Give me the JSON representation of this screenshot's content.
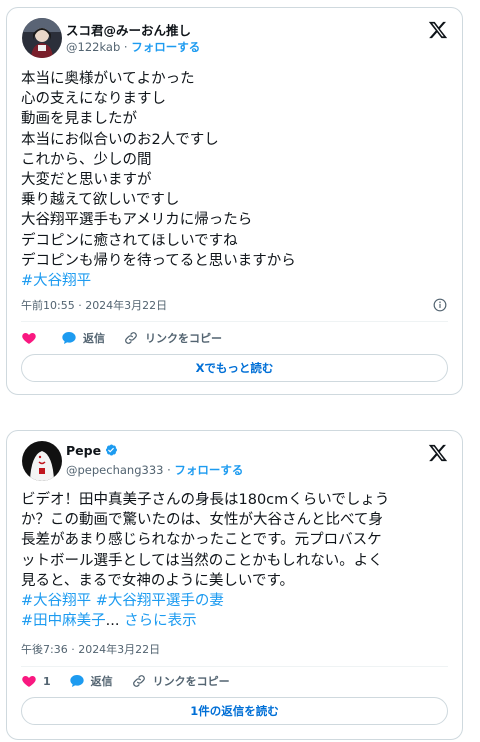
{
  "colors": {
    "accent": "#1d9bf0",
    "text": "#0f1419",
    "muted": "#536471",
    "like": "#f91880",
    "border": "#cfd9de"
  },
  "tweet1": {
    "name": "スコ君@みーおん推し",
    "handle": "@122kab",
    "separator": "·",
    "follow_label": "フォローする",
    "body_lines": [
      "本当に奥様がいてよかった",
      "心の支えになりますし",
      "動画を見ましたが",
      "本当にお似合いのお2人ですし",
      "これから、少しの間",
      "大変だと思いますが",
      "乗り越えて欲しいですし",
      "大谷翔平選手もアメリカに帰ったら",
      "デコピンに癒されてほしいですね",
      "デコピンも帰りを待ってると思いますから"
    ],
    "hashtag": "#大谷翔平",
    "timestamp": "午前10:55 · 2024年3月22日",
    "like_count": "",
    "reply_label": "返信",
    "copy_link_label": "リンクをコピー",
    "cta_label": "Xでもっと読む"
  },
  "tweet2": {
    "name": "Pepe",
    "handle": "@pepechang333",
    "separator": "·",
    "follow_label": "フォローする",
    "body_lines": [
      "ビデオ！田中真美子さんの身長は180cmくらいでしょう",
      "か？この動画で驚いたのは、女性が大谷さんと比べて身",
      "長差があまり感じられなかったことです。元プロバスケ",
      "ットボール選手としては当然のことかもしれない。よく",
      "見ると、まるで女神のように美しいです。"
    ],
    "hashtags_line1": [
      "#大谷翔平",
      "#大谷翔平選手の妻"
    ],
    "hashtag_line2": "#田中麻美子",
    "ellipsis": "...",
    "show_more_label": "さらに表示",
    "timestamp": "午後7:36 · 2024年3月22日",
    "like_count": "1",
    "reply_label": "返信",
    "copy_link_label": "リンクをコピー",
    "cta_label": "1件の返信を読む"
  }
}
